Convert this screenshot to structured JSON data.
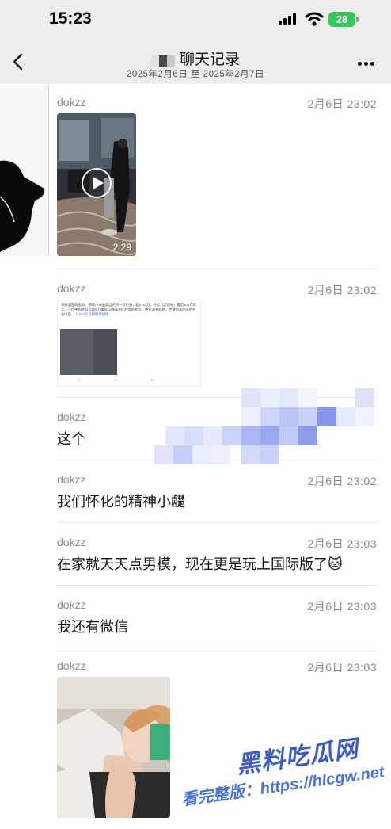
{
  "status_bar": {
    "time": "15:23",
    "battery": "28"
  },
  "header": {
    "title": "聊天记录",
    "subtitle": "2025年2月6日 至 2025年2月7日"
  },
  "messages": [
    {
      "sender": "dokzz",
      "time": "2月6日 23:02",
      "type": "video",
      "duration": "2:29"
    },
    {
      "sender": "dokzz",
      "time": "2月6日 23:02",
      "type": "image",
      "preview": {
        "text": "青瓶酒乱前委会：挪威小伙拍卖自己的一次约会，起价10刀，经过几次竞拍，最后200刀成交。一位中国贵妇以200刀赢得与挪威小伙约会的机会，中外游客起哄，连请创客明天的约会内容。",
        "link": "11024号总部微博视频",
        "stats": [
          "1",
          "3",
          "19"
        ]
      }
    },
    {
      "sender": "dokzz",
      "time": "",
      "type": "text",
      "text": "这个"
    },
    {
      "sender": "dokzz",
      "time": "2月6日 23:02",
      "type": "text",
      "text": "我们怀化的精神小𬺓"
    },
    {
      "sender": "dokzz",
      "time": "2月6日 23:03",
      "type": "text",
      "text": "在家就天天点男模，现在更是玩上国际版了🐱"
    },
    {
      "sender": "dokzz",
      "time": "2月6日 23:03",
      "type": "text",
      "text": "我还有微信"
    },
    {
      "sender": "dokzz",
      "time": "2月6日 23:03",
      "type": "image"
    }
  ],
  "watermark": {
    "title": "黑料吃瓜网",
    "url": "看完整版：https://hlcgw.net"
  },
  "colors": {
    "header_bg": "#ededed",
    "watermark": "#3c5ccc",
    "battery": "#34c759"
  }
}
